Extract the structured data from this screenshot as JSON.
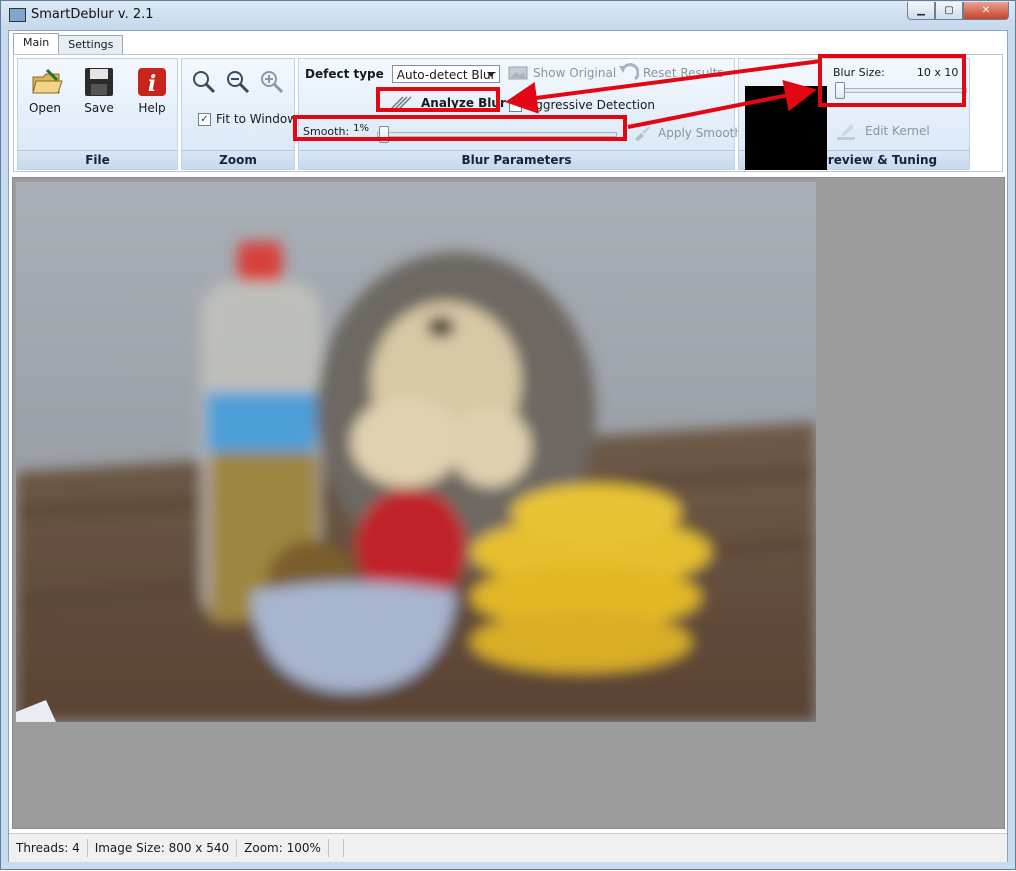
{
  "window": {
    "title": "SmartDeblur v. 2.1"
  },
  "tabs": [
    {
      "label": "Main"
    },
    {
      "label": "Settings"
    }
  ],
  "file_group": {
    "label": "File",
    "open_label": "Open",
    "save_label": "Save",
    "help_label": "Help"
  },
  "zoom_group": {
    "label": "Zoom",
    "fit_to_window_label": "Fit to Window",
    "fit_to_window_checked": true
  },
  "blur_params": {
    "label": "Blur Parameters",
    "defect_type_label": "Defect type",
    "defect_type_value": "Auto-detect Blur",
    "show_original_label": "Show Original",
    "reset_results_label": "Reset Results",
    "analyze_blur_label": "Analyze Blur",
    "aggressive_detection_label": "Aggressive Detection",
    "aggressive_detection_checked": false,
    "smooth_label": "Smooth:",
    "smooth_value_text": "1%",
    "smooth_value": 1,
    "apply_smooth_label": "Apply Smooth"
  },
  "kernel": {
    "label": "Kernel Preview & Tuning",
    "blur_size_label": "Blur Size:",
    "blur_size_value": "10 x 10",
    "edit_kernel_label": "Edit Kernel"
  },
  "status": {
    "threads": "Threads: 4",
    "image_size": "Image Size: 800 x 540",
    "zoom": "Zoom: 100%"
  },
  "colors": {
    "annotation_red": "#e30613",
    "viewport_gray": "#9c9c9c"
  }
}
